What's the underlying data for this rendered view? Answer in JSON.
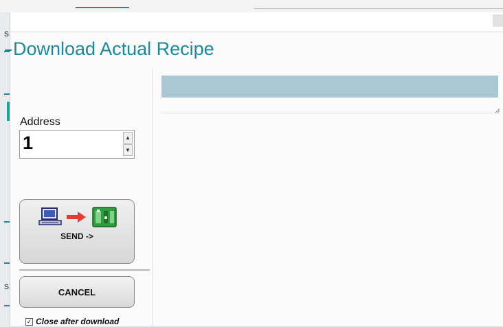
{
  "dialog": {
    "title": "Download Actual Recipe"
  },
  "address": {
    "label": "Address",
    "value": "1"
  },
  "send_button": {
    "label": "SEND ->"
  },
  "cancel_button": {
    "label": "CANCEL"
  },
  "close_after_download": {
    "label": "Close after download",
    "checked": true
  },
  "colors": {
    "title": "#1c8a9b",
    "header_bar": "#a9c7d4",
    "arrow": "#e53935",
    "device": "#2e9d3b"
  },
  "icons": [
    "computer-icon",
    "arrow-right-icon",
    "device-icon",
    "spin-up-icon",
    "spin-down-icon",
    "checkmark-icon",
    "resize-grip-icon"
  ],
  "background": {
    "letters": [
      "s",
      "s"
    ]
  }
}
